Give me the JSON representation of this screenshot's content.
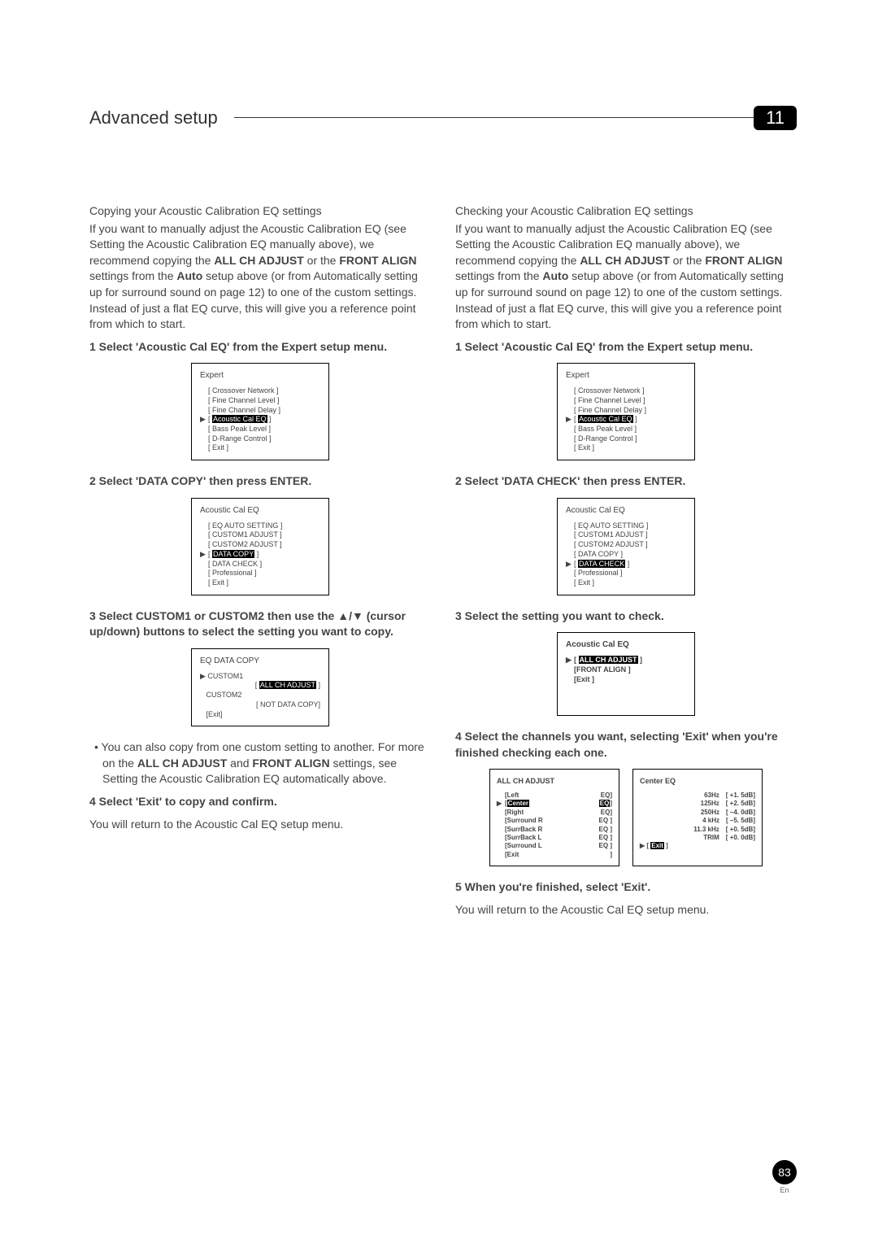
{
  "header": {
    "section_title": "Advanced setup",
    "chapter_number": "11"
  },
  "left": {
    "sub1": "Copying your Acoustic Calibration EQ settings",
    "intro_part1": "If you want to manually adjust the Acoustic Calibration EQ (see ",
    "intro_link1": "Setting the Acoustic Calibration EQ manually",
    "intro_part2": " above), we recommend copying the ",
    "intro_bold1": "ALL CH ADJUST",
    "intro_part3": " or the ",
    "intro_bold2": "FRONT ALIGN",
    "intro_part4": " settings from the ",
    "intro_bold3": "Auto",
    "intro_part5": " setup above (or from ",
    "intro_link2": "Automatically setting up for surround sound",
    "intro_part6": " on page 12) to one of the custom settings. Instead of just a flat EQ curve, this will give you a reference point from which to start.",
    "step1": "1    Select 'Acoustic Cal EQ' from the Expert setup menu.",
    "osd1": {
      "title": "Expert",
      "line1": "[ Crossover Network    ]",
      "line2": "[ Fine Channel Level ]",
      "line3": "[ Fine Channel Delay ]",
      "line4_hl": "Acoustic Cal EQ",
      "line5": "[ Bass Peak Level       ]",
      "line6": "[ D-Range Control      ]",
      "line7": "[ Exit                            ]"
    },
    "step2": "2    Select 'DATA COPY' then press ENTER.",
    "osd2": {
      "title": "Acoustic  Cal  EQ",
      "line1": "[ EQ AUTO SETTING ]",
      "line2": "[ CUSTOM1 ADJUST ]",
      "line3": "[ CUSTOM2 ADJUST ]",
      "line4_hl": "DATA COPY",
      "line5": "[ DATA CHECK           ]",
      "line6": "[ Professional              ]",
      "line7": "[ Exit                             ]"
    },
    "step3": "3    Select CUSTOM1 or CUSTOM2 then use the ▲/▼ (cursor up/down) buttons to select the setting you want to copy.",
    "osd3": {
      "title": "EQ  DATA  COPY",
      "c1": "CUSTOM1",
      "c1_hl": "ALL CH ADJUST",
      "c2": "CUSTOM2",
      "c2_val": "[ NOT DATA COPY]",
      "exit": "[Exit]"
    },
    "bullet_part1": "• You can also copy from one custom setting to another. For more on the ",
    "bullet_bold1": "ALL CH ADJUST",
    "bullet_part2": " and ",
    "bullet_bold2": "FRONT ALIGN",
    "bullet_part3": " settings, see ",
    "bullet_link": "Setting the Acoustic Calibration EQ automatically",
    "bullet_part4": " above.",
    "step4": "4    Select 'Exit' to copy and confirm.",
    "tail": "You will return to the Acoustic Cal EQ setup menu."
  },
  "right": {
    "sub1": "Checking your Acoustic Calibration EQ settings",
    "intro_part1": "If you want to manually adjust the Acoustic Calibration EQ (see ",
    "intro_link1": "Setting the Acoustic Calibration EQ manually",
    "intro_part2": " above), we recommend copying the ",
    "intro_bold1": "ALL CH ADJUST",
    "intro_part3": " or the ",
    "intro_bold2": "FRONT ALIGN",
    "intro_part4": " settings from the ",
    "intro_bold3": "Auto",
    "intro_part5": " setup above (or from ",
    "intro_link2": "Automatically setting up for surround sound",
    "intro_part6": " on page 12) to one of the custom settings. Instead of just a flat EQ curve, this will give you a reference point from which to start.",
    "step1": "1    Select 'Acoustic Cal EQ' from the Expert setup menu.",
    "osd1": {
      "title": "Expert",
      "line1": "[ Crossover Network    ]",
      "line2": "[ Fine Channel Level ]",
      "line3": "[ Fine Channel Delay ]",
      "line4_hl": "Acoustic Cal EQ",
      "line5": "[ Bass Peak Level       ]",
      "line6": "[ D-Range Control      ]",
      "line7": "[ Exit                            ]"
    },
    "step2": "2    Select 'DATA CHECK' then press ENTER.",
    "osd2": {
      "title": "Acoustic  Cal  EQ",
      "line1": "[ EQ AUTO SETTING ]",
      "line2": "[ CUSTOM1 ADJUST ]",
      "line3": "[ CUSTOM2 ADJUST ]",
      "line4": "[ DATA COPY              ]",
      "line5_hl": "DATA CHECK",
      "line6": "[ Professional              ]",
      "line7": "[ Exit                             ]"
    },
    "step3": "3    Select the setting you want to check.",
    "osd3": {
      "title": "Acoustic  Cal  EQ",
      "line1_hl": "ALL CH ADJUST",
      "line2": "[FRONT ALIGN     ]",
      "line3": "[Exit                      ]"
    },
    "step4": "4    Select the channels you want, selecting 'Exit' when you're finished checking each one.",
    "osd4a": {
      "title": "ALL  CH  ADJUST",
      "l1a": "[Left",
      "l1b": "EQ]",
      "l2a_hl": "Center",
      "l2b_hl": "EQ",
      "l3a": "[Right",
      "l3b": "EQ]",
      "l4a": "[Surround R",
      "l4b": "EQ ]",
      "l5a": "[SurrBack R",
      "l5b": "EQ ]",
      "l6a": "[SurrBack L",
      "l6b": "EQ ]",
      "l7a": "[Surround L",
      "l7b": "EQ ]",
      "l8a": "[Exit",
      "l8b": "]"
    },
    "osd4b": {
      "title": "Center  EQ",
      "r1a": "63Hz",
      "r1b": "[   +1. 5dB]",
      "r2a": "125Hz",
      "r2b": "[   +2. 5dB]",
      "r3a": "250Hz",
      "r3b": "[   –4. 0dB]",
      "r4a": "4 kHz",
      "r4b": "[   –5. 5dB]",
      "r5a": "11.3 kHz",
      "r5b": "[   +0. 5dB]",
      "r6a": "TRIM",
      "r6b": "[   +0. 0dB]",
      "exit_hl": "Exit"
    },
    "step5": "5    When you're finished, select 'Exit'.",
    "tail": "You will return to the Acoustic Cal EQ setup menu."
  },
  "footer": {
    "page": "83",
    "lang": "En"
  }
}
